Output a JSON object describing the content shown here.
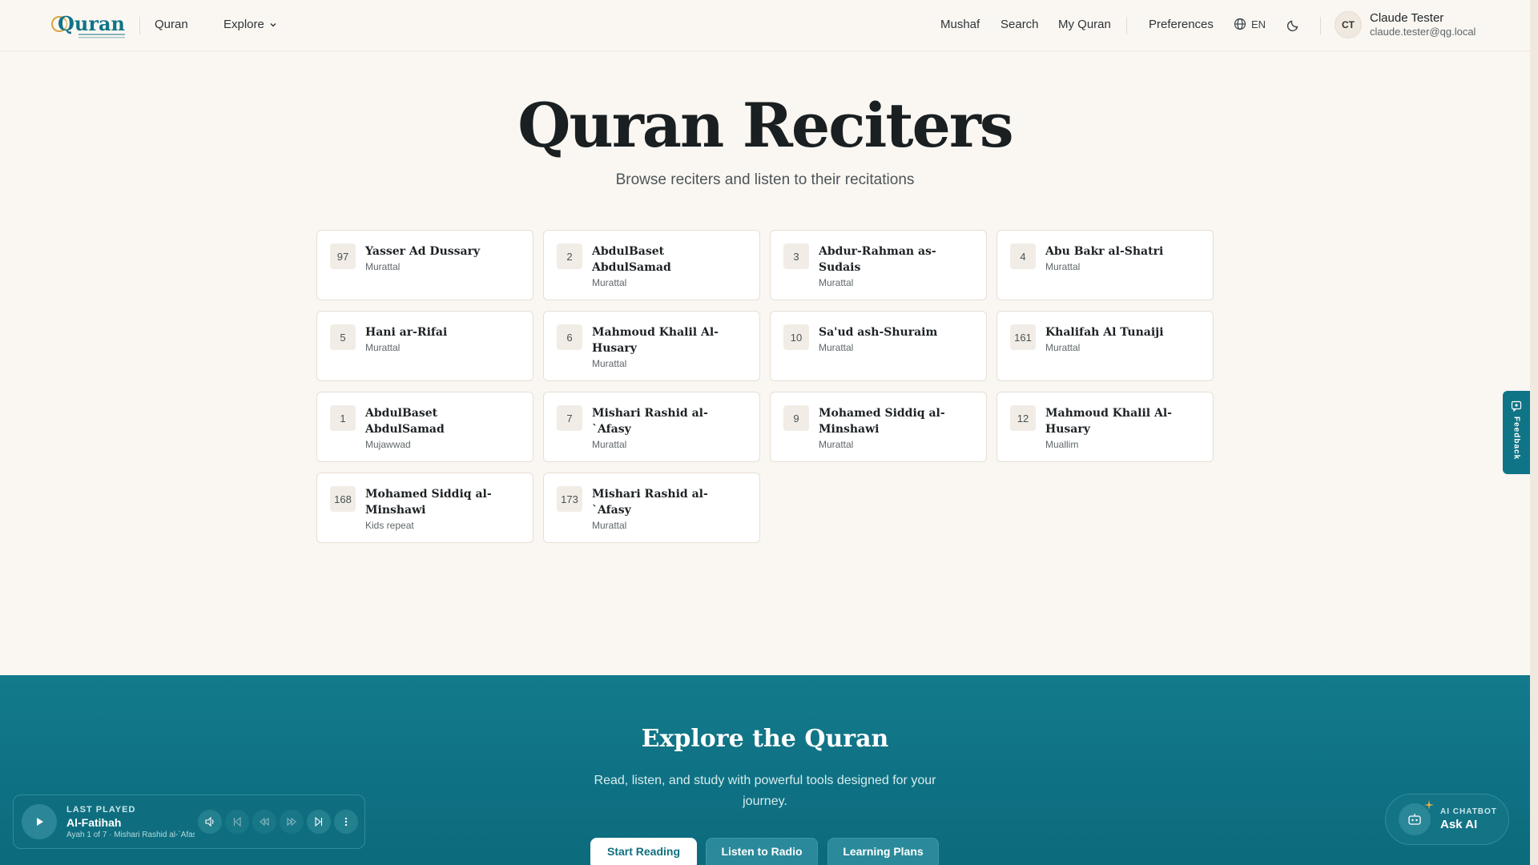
{
  "header": {
    "logo_text": "Quran",
    "nav_left": [
      {
        "label": "Quran"
      },
      {
        "label": "Explore"
      }
    ],
    "nav_right": [
      {
        "label": "Mushaf"
      },
      {
        "label": "Search"
      },
      {
        "label": "My Quran"
      },
      {
        "label": "Preferences"
      }
    ],
    "language": "EN",
    "user": {
      "initials": "CT",
      "name": "Claude Tester",
      "email": "claude.tester@qg.local"
    }
  },
  "hero": {
    "title": "Quran Reciters",
    "subtitle": "Browse reciters and listen to their recitations"
  },
  "reciters": [
    {
      "id": "97",
      "name": "Yasser Ad Dussary",
      "style": "Murattal"
    },
    {
      "id": "2",
      "name": "AbdulBaset AbdulSamad",
      "style": "Murattal"
    },
    {
      "id": "3",
      "name": "Abdur-Rahman as-Sudais",
      "style": "Murattal"
    },
    {
      "id": "4",
      "name": "Abu Bakr al-Shatri",
      "style": "Murattal"
    },
    {
      "id": "5",
      "name": "Hani ar-Rifai",
      "style": "Murattal"
    },
    {
      "id": "6",
      "name": "Mahmoud Khalil Al-Husary",
      "style": "Murattal"
    },
    {
      "id": "10",
      "name": "Sa'ud ash-Shuraim",
      "style": "Murattal"
    },
    {
      "id": "161",
      "name": "Khalifah Al Tunaiji",
      "style": "Murattal"
    },
    {
      "id": "1",
      "name": "AbdulBaset AbdulSamad",
      "style": "Mujawwad"
    },
    {
      "id": "7",
      "name": "Mishari Rashid al-`Afasy",
      "style": "Murattal"
    },
    {
      "id": "9",
      "name": "Mohamed Siddiq al-Minshawi",
      "style": "Murattal"
    },
    {
      "id": "12",
      "name": "Mahmoud Khalil Al-Husary",
      "style": "Muallim"
    },
    {
      "id": "168",
      "name": "Mohamed Siddiq al-Minshawi",
      "style": "Kids repeat"
    },
    {
      "id": "173",
      "name": "Mishari Rashid al-`Afasy",
      "style": "Murattal"
    }
  ],
  "explore": {
    "title": "Explore the Quran",
    "subtitle": "Read, listen, and study with powerful tools designed for your journey.",
    "buttons": [
      {
        "label": "Start Reading"
      },
      {
        "label": "Listen to Radio"
      },
      {
        "label": "Learning Plans"
      }
    ]
  },
  "feedback": {
    "label": "Feedback"
  },
  "player": {
    "label": "LAST PLAYED",
    "title": "Al-Fatihah",
    "meta": "Ayah 1 of 7 · Mishari Rashid al-`Afasy"
  },
  "ai": {
    "label": "AI CHATBOT",
    "title": "Ask AI"
  },
  "colors": {
    "background": "#faf7f2",
    "primary": "#0f7486",
    "card": "#ffffff"
  }
}
